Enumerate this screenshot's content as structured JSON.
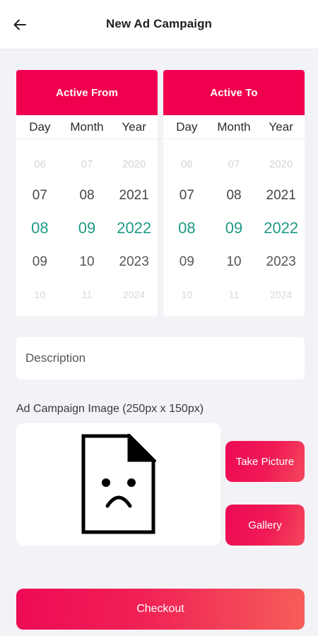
{
  "header": {
    "title": "New Ad Campaign",
    "back_icon": "arrow-left-icon"
  },
  "pickers": {
    "from": {
      "title": "Active From",
      "columns": [
        "Day",
        "Month",
        "Year"
      ],
      "rows": [
        [
          "06",
          "07",
          "2020"
        ],
        [
          "07",
          "08",
          "2021"
        ],
        [
          "08",
          "09",
          "2022"
        ],
        [
          "09",
          "10",
          "2023"
        ],
        [
          "10",
          "11",
          "2024"
        ]
      ],
      "selected": {
        "day": "08",
        "month": "09",
        "year": "2022"
      }
    },
    "to": {
      "title": "Active To",
      "columns": [
        "Day",
        "Month",
        "Year"
      ],
      "rows": [
        [
          "06",
          "07",
          "2020"
        ],
        [
          "07",
          "08",
          "2021"
        ],
        [
          "08",
          "09",
          "2022"
        ],
        [
          "09",
          "10",
          "2023"
        ],
        [
          "10",
          "11",
          "2024"
        ]
      ],
      "selected": {
        "day": "08",
        "month": "09",
        "year": "2022"
      }
    }
  },
  "description": {
    "placeholder": "Description",
    "value": ""
  },
  "image_section": {
    "label": "Ad Campaign Image (250px x 150px)",
    "placeholder_icon": "sad-file-icon",
    "take_picture_label": "Take Picture",
    "gallery_label": "Gallery"
  },
  "checkout_label": "Checkout",
  "colors": {
    "accent": "#f1004f",
    "selected_value": "#1f9a86",
    "background": "#f3f2f7"
  }
}
